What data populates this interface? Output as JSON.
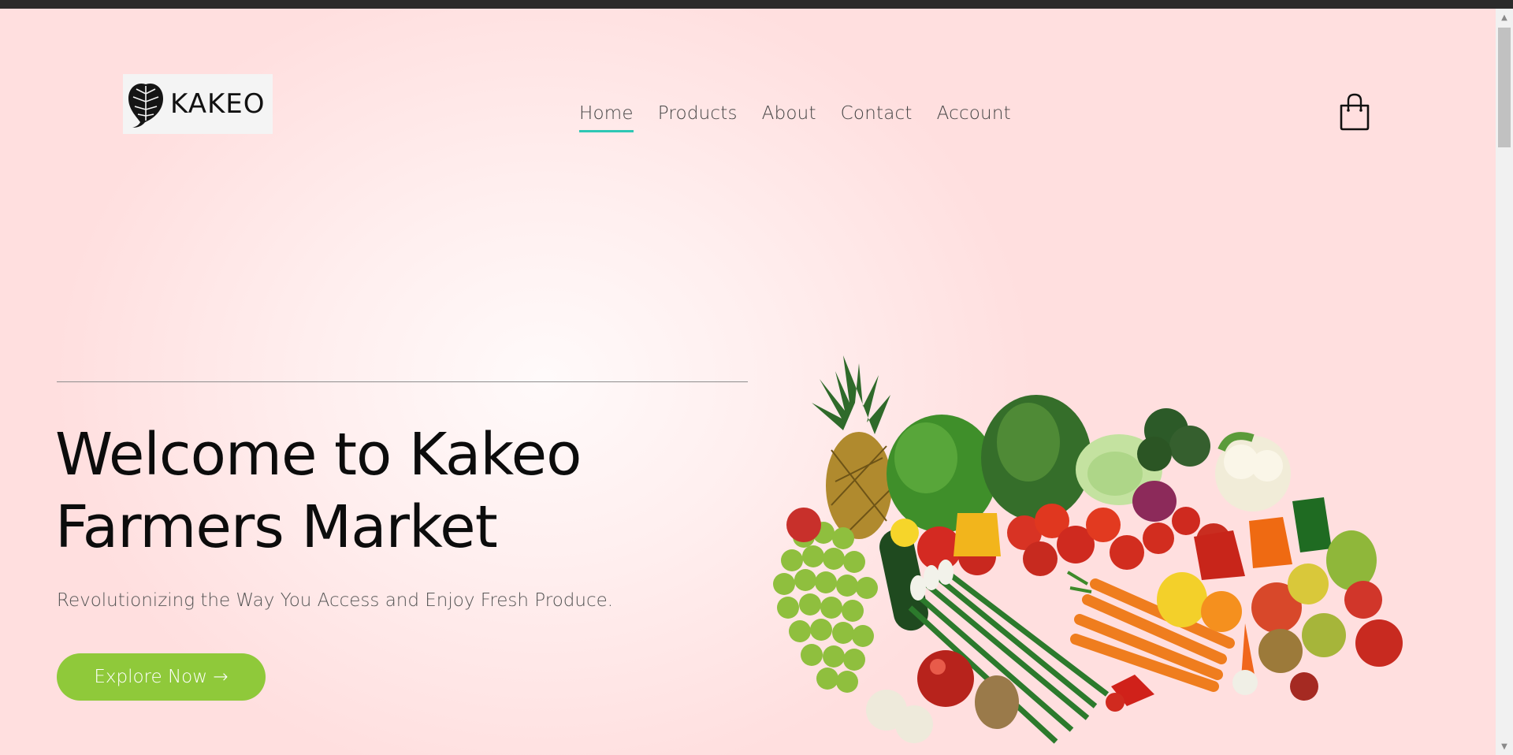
{
  "brand": {
    "name": "KAKEO",
    "logo_icon": "leaf-icon"
  },
  "nav": {
    "items": [
      {
        "label": "Home",
        "active": true
      },
      {
        "label": "Products",
        "active": false
      },
      {
        "label": "About",
        "active": false
      },
      {
        "label": "Contact",
        "active": false
      },
      {
        "label": "Account",
        "active": false
      }
    ],
    "active_color": "#2ec7b4"
  },
  "cart": {
    "icon": "shopping-bag-icon"
  },
  "hero": {
    "title_line1": "Welcome to Kakeo",
    "title_line2": "Farmers Market",
    "subtitle": "Revolutionizing the Way You Access and Enjoy Fresh Produce.",
    "cta_label": "Explore Now →",
    "cta_color": "#8fc93a",
    "image": "fresh-produce-image"
  }
}
